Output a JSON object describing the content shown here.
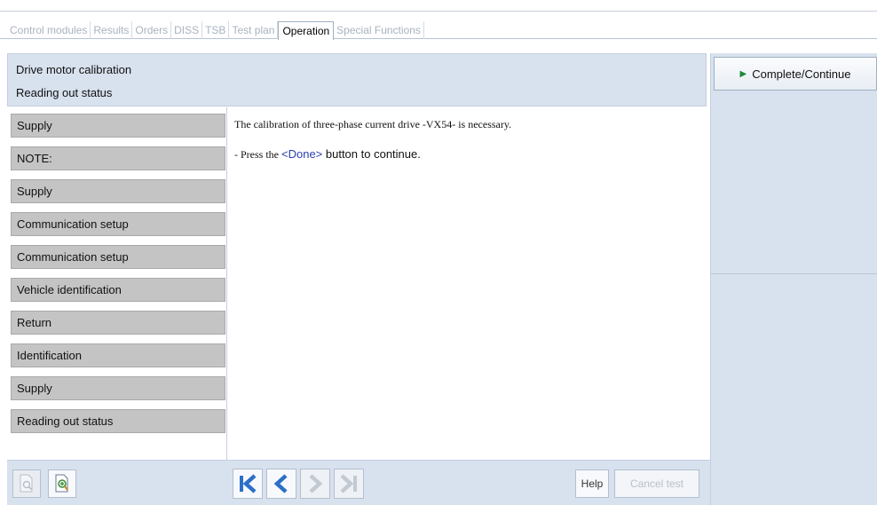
{
  "tabs": [
    {
      "label": "Control modules",
      "active": false
    },
    {
      "label": "Results",
      "active": false
    },
    {
      "label": "Orders",
      "active": false
    },
    {
      "label": "DISS",
      "active": false
    },
    {
      "label": "TSB",
      "active": false
    },
    {
      "label": "Test plan",
      "active": false
    },
    {
      "label": "Operation",
      "active": true
    },
    {
      "label": "Special Functions",
      "active": false
    }
  ],
  "header": {
    "title": "Drive motor calibration",
    "subtitle": "Reading out status"
  },
  "right_panel": {
    "complete_label": "Complete/Continue"
  },
  "steps": [
    {
      "label": "Supply"
    },
    {
      "label": "NOTE:"
    },
    {
      "label": "Supply"
    },
    {
      "label": "Communication setup"
    },
    {
      "label": "Communication setup"
    },
    {
      "label": "Vehicle identification"
    },
    {
      "label": "Return"
    },
    {
      "label": "Identification"
    },
    {
      "label": "Supply"
    },
    {
      "label": "Reading out status"
    }
  ],
  "message": {
    "line1": "The calibration of three-phase current drive -VX54- is necessary.",
    "line2_prefix": "- Press the ",
    "line2_done": "<Done>",
    "line2_suffix": " button to continue."
  },
  "bottom": {
    "help_label": "Help",
    "cancel_label": "Cancel test"
  },
  "colors": {
    "accent_blue": "#2b6fc9",
    "disabled_gray": "#c3cad4",
    "play_green": "#1f8a3b",
    "panel_bg": "#d8e1ee"
  },
  "icons": {
    "doc_search_disabled": "document-search-icon",
    "doc_zoom": "document-zoom-icon",
    "first": "skip-first-icon",
    "prev": "previous-icon",
    "next": "next-icon",
    "last": "skip-last-icon",
    "play": "play-icon"
  }
}
